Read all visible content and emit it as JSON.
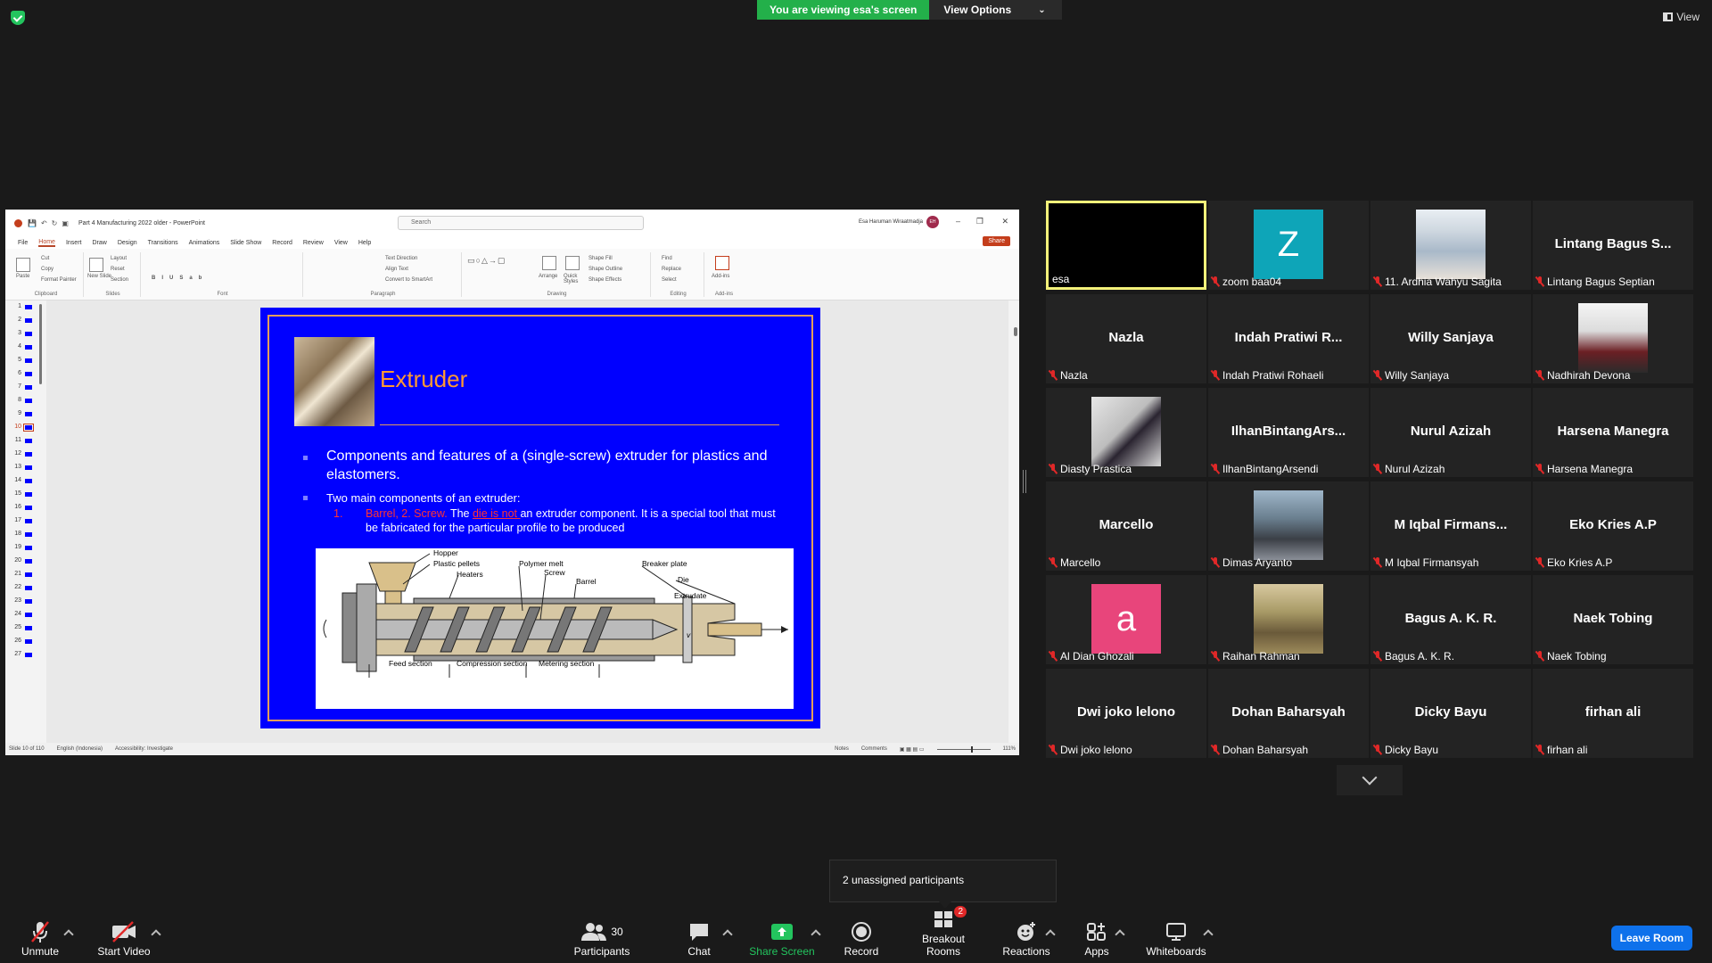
{
  "top": {
    "banner_text": "You are viewing esa's screen",
    "view_options_label": "View Options",
    "view_label": "View"
  },
  "ppt": {
    "file_title": "Part 4 Manufacturing 2022 older  -  PowerPoint",
    "search_placeholder": "Search",
    "user_name": "Esa Haruman Wiraatmadja",
    "user_initials": "EH",
    "share_label": "Share",
    "tabs": [
      "File",
      "Home",
      "Insert",
      "Draw",
      "Design",
      "Transitions",
      "Animations",
      "Slide Show",
      "Record",
      "Review",
      "View",
      "Help"
    ],
    "ribbon_groups": [
      "Clipboard",
      "Slides",
      "Font",
      "Paragraph",
      "Drawing",
      "Editing",
      "Add-ins"
    ],
    "ribbon_buttons": {
      "paste": "Paste",
      "cut": "Cut",
      "copy": "Copy",
      "format_painter": "Format Painter",
      "new_slide": "New Slide",
      "layout": "Layout",
      "reset": "Reset",
      "section": "Section",
      "text_direction": "Text Direction",
      "align_text": "Align Text",
      "convert_smartart": "Convert to SmartArt",
      "arrange": "Arrange",
      "quick_styles": "Quick Styles",
      "shape_fill": "Shape Fill",
      "shape_outline": "Shape Outline",
      "shape_effects": "Shape Effects",
      "find": "Find",
      "replace": "Replace",
      "select": "Select",
      "addins": "Add-ins"
    },
    "slide_numbers": [
      "1",
      "2",
      "3",
      "4",
      "5",
      "6",
      "7",
      "8",
      "9",
      "10",
      "11",
      "12",
      "13",
      "14",
      "15",
      "16",
      "17",
      "18",
      "19",
      "20",
      "21",
      "22",
      "23",
      "24",
      "25",
      "26",
      "27"
    ],
    "active_slide": "10",
    "status": {
      "slide_of": "Slide 10 of 110",
      "language": "English (Indonesia)",
      "accessibility": "Accessibility: Investigate",
      "notes": "Notes",
      "comments": "Comments",
      "zoom": "111%"
    }
  },
  "slide": {
    "title": "Extruder",
    "bullet1": "Components and features of a (single-screw) extruder for plastics and elastomers.",
    "bullet2": "Two main components of an extruder:",
    "sub_num": "1.",
    "sub_red": "Barrel, 2. Screw.",
    "sub_the": " The ",
    "sub_die_is_not": "die is not ",
    "sub_rest": "an extruder component. It is a special tool that must be fabricated for the particular profile to be produced",
    "diagram_labels": {
      "hopper": "Hopper",
      "plastic_pellets": "Plastic pellets",
      "heaters": "Heaters",
      "polymer_melt": "Polymer melt",
      "screw": "Screw",
      "barrel": "Barrel",
      "breaker_plate": "Breaker plate",
      "die": "Die",
      "extrudate": "Extrudate",
      "v": "v",
      "feed_section": "Feed section",
      "compression_section": "Compression section",
      "metering_section": "Metering section"
    }
  },
  "participants": [
    {
      "name": "esa",
      "display": "",
      "type": "video-black",
      "muted": false,
      "active": true
    },
    {
      "name": "zoom baa04",
      "display": "Z",
      "type": "letter",
      "color": "#0ea5b8",
      "muted": true
    },
    {
      "name": "11. Ardhia Wahyu Sagita",
      "display": "",
      "type": "photo",
      "muted": true
    },
    {
      "name": "Lintang Bagus Septian",
      "display": "Lintang Bagus S...",
      "type": "name",
      "muted": true
    },
    {
      "name": "Nazla",
      "display": "Nazla",
      "type": "name",
      "muted": true
    },
    {
      "name": "Indah Pratiwi Rohaeli",
      "display": "Indah Pratiwi R...",
      "type": "name",
      "muted": true
    },
    {
      "name": "Willy Sanjaya",
      "display": "Willy Sanjaya",
      "type": "name",
      "muted": true
    },
    {
      "name": "Nadhirah Devona",
      "display": "",
      "type": "photo",
      "muted": true
    },
    {
      "name": "Diasty Prastica",
      "display": "",
      "type": "photo",
      "muted": true
    },
    {
      "name": "IlhanBintangArsendi",
      "display": "IlhanBintangArs...",
      "type": "name",
      "muted": true
    },
    {
      "name": "Nurul Azizah",
      "display": "Nurul Azizah",
      "type": "name",
      "muted": true
    },
    {
      "name": "Harsena Manegra",
      "display": "Harsena Manegra",
      "type": "name",
      "muted": true
    },
    {
      "name": "Marcello",
      "display": "Marcello",
      "type": "name",
      "muted": true
    },
    {
      "name": "Dimas Aryanto",
      "display": "",
      "type": "photo",
      "muted": true
    },
    {
      "name": "M Iqbal Firmansyah",
      "display": "M Iqbal Firmans...",
      "type": "name",
      "muted": true
    },
    {
      "name": "Eko Kries A.P",
      "display": "Eko Kries A.P",
      "type": "name",
      "muted": true
    },
    {
      "name": "Al Dian Ghozali",
      "display": "a",
      "type": "letter",
      "color": "#e8457b",
      "muted": true
    },
    {
      "name": "Raihan Rahman",
      "display": "",
      "type": "photo",
      "muted": true
    },
    {
      "name": "Bagus A. K. R.",
      "display": "Bagus A. K. R.",
      "type": "name",
      "muted": true
    },
    {
      "name": "Naek Tobing",
      "display": "Naek Tobing",
      "type": "name",
      "muted": true
    },
    {
      "name": "Dwi joko lelono",
      "display": "Dwi joko lelono",
      "type": "name",
      "muted": true
    },
    {
      "name": "Dohan Baharsyah",
      "display": "Dohan Baharsyah",
      "type": "name",
      "muted": true
    },
    {
      "name": "Dicky Bayu",
      "display": "Dicky Bayu",
      "type": "name",
      "muted": true
    },
    {
      "name": "firhan ali",
      "display": "firhan ali",
      "type": "name",
      "muted": true
    }
  ],
  "tooltip": "2 unassigned participants",
  "toolbar": {
    "unmute": "Unmute",
    "start_video": "Start Video",
    "participants": "Participants",
    "participants_count": "30",
    "chat": "Chat",
    "share_screen": "Share Screen",
    "record": "Record",
    "breakout_rooms": "Breakout Rooms",
    "breakout_badge": "2",
    "reactions": "Reactions",
    "apps": "Apps",
    "whiteboards": "Whiteboards",
    "leave_room": "Leave Room"
  },
  "colors": {
    "banner_green": "#23b04a",
    "leave_blue": "#0e71eb",
    "slide_blue": "#0000ff",
    "slide_accent": "#ff9933"
  }
}
